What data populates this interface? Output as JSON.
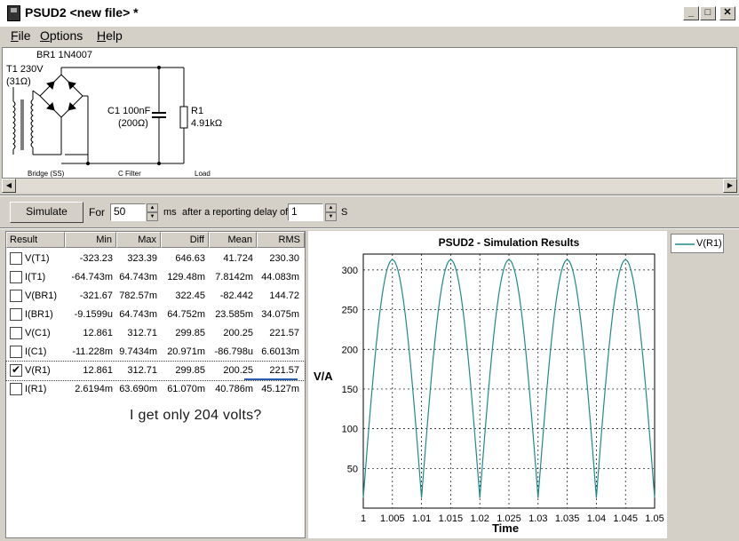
{
  "window": {
    "title": "PSUD2  <new file> *",
    "controls": {
      "minimize": "_",
      "maximize": "□",
      "close": "✕"
    }
  },
  "menu": [
    {
      "label": "File",
      "accel": "F",
      "rest": "ile"
    },
    {
      "label": "Options",
      "accel": "O",
      "rest": "ptions"
    },
    {
      "label": "Help",
      "accel": "H",
      "rest": "elp"
    }
  ],
  "schematic": {
    "transformer_name": "T1 230V",
    "transformer_resistance": "(31Ω)",
    "bridge_name": "BR1 1N4007",
    "capacitor_name": "C1 100nF",
    "capacitor_resistance": "(200Ω)",
    "resistor_name": "R1",
    "resistor_value": "4.91kΩ",
    "section_bridge": "Bridge (SS)",
    "section_filter": "C Filter",
    "section_load": "Load"
  },
  "controls": {
    "simulate_label": "Simulate",
    "for_label": "For",
    "duration_value": "50",
    "duration_unit": "ms",
    "delay_label": "after a reporting delay of",
    "delay_value": "1",
    "delay_unit": "S"
  },
  "results": {
    "columns": [
      "Result",
      "Min",
      "Max",
      "Diff",
      "Mean",
      "RMS"
    ],
    "rows": [
      {
        "checked": false,
        "name": "V(T1)",
        "min": "-323.23",
        "max": "323.39",
        "diff": "646.63",
        "mean": "41.724",
        "rms": "230.30"
      },
      {
        "checked": false,
        "name": "I(T1)",
        "min": "-64.743m",
        "max": "64.743m",
        "diff": "129.48m",
        "mean": "7.8142m",
        "rms": "44.083m"
      },
      {
        "checked": false,
        "name": "V(BR1)",
        "min": "-321.67",
        "max": "782.57m",
        "diff": "322.45",
        "mean": "-82.442",
        "rms": "144.72"
      },
      {
        "checked": false,
        "name": "I(BR1)",
        "min": "-9.1599u",
        "max": "64.743m",
        "diff": "64.752m",
        "mean": "23.585m",
        "rms": "34.075m"
      },
      {
        "checked": false,
        "name": "V(C1)",
        "min": "12.861",
        "max": "312.71",
        "diff": "299.85",
        "mean": "200.25",
        "rms": "221.57"
      },
      {
        "checked": false,
        "name": "I(C1)",
        "min": "-11.228m",
        "max": "9.7434m",
        "diff": "20.971m",
        "mean": "-86.798u",
        "rms": "6.6013m"
      },
      {
        "checked": true,
        "name": "V(R1)",
        "min": "12.861",
        "max": "312.71",
        "diff": "299.85",
        "mean": "200.25",
        "rms": "221.57"
      },
      {
        "checked": false,
        "name": "I(R1)",
        "min": "2.6194m",
        "max": "63.690m",
        "diff": "61.070m",
        "mean": "40.786m",
        "rms": "45.127m"
      }
    ],
    "check_glyph": "✔"
  },
  "annotation": "I get only 204 volts?",
  "colors": {
    "series": "#1f8a8a",
    "annotation_underline": "#2a5db0"
  },
  "chart_data": {
    "type": "line",
    "title": "PSUD2 - Simulation Results",
    "xlabel": "Time",
    "ylabel": "V/A",
    "xlim": [
      1,
      1.05
    ],
    "ylim": [
      0,
      320
    ],
    "x_ticks": [
      "1",
      "1.005",
      "1.01",
      "1.015",
      "1.02",
      "1.025",
      "1.03",
      "1.035",
      "1.04",
      "1.045",
      "1.05"
    ],
    "y_ticks": [
      "50",
      "100",
      "150",
      "200",
      "250",
      "300"
    ],
    "grid": true,
    "legend": "top-right outside",
    "series": [
      {
        "name": "V(R1)",
        "x": [
          1.0,
          1.0025,
          1.005,
          1.0075,
          1.01,
          1.0125,
          1.015,
          1.0175,
          1.02,
          1.0225,
          1.025,
          1.0275,
          1.03,
          1.0325,
          1.035,
          1.0375,
          1.04,
          1.0425,
          1.045,
          1.0475,
          1.05
        ],
        "y": [
          12.9,
          221,
          312.7,
          221,
          12.9,
          221,
          312.7,
          221,
          12.9,
          221,
          312.7,
          221,
          12.9,
          221,
          312.7,
          221,
          12.9,
          221,
          312.7,
          221,
          12.9
        ]
      }
    ]
  }
}
